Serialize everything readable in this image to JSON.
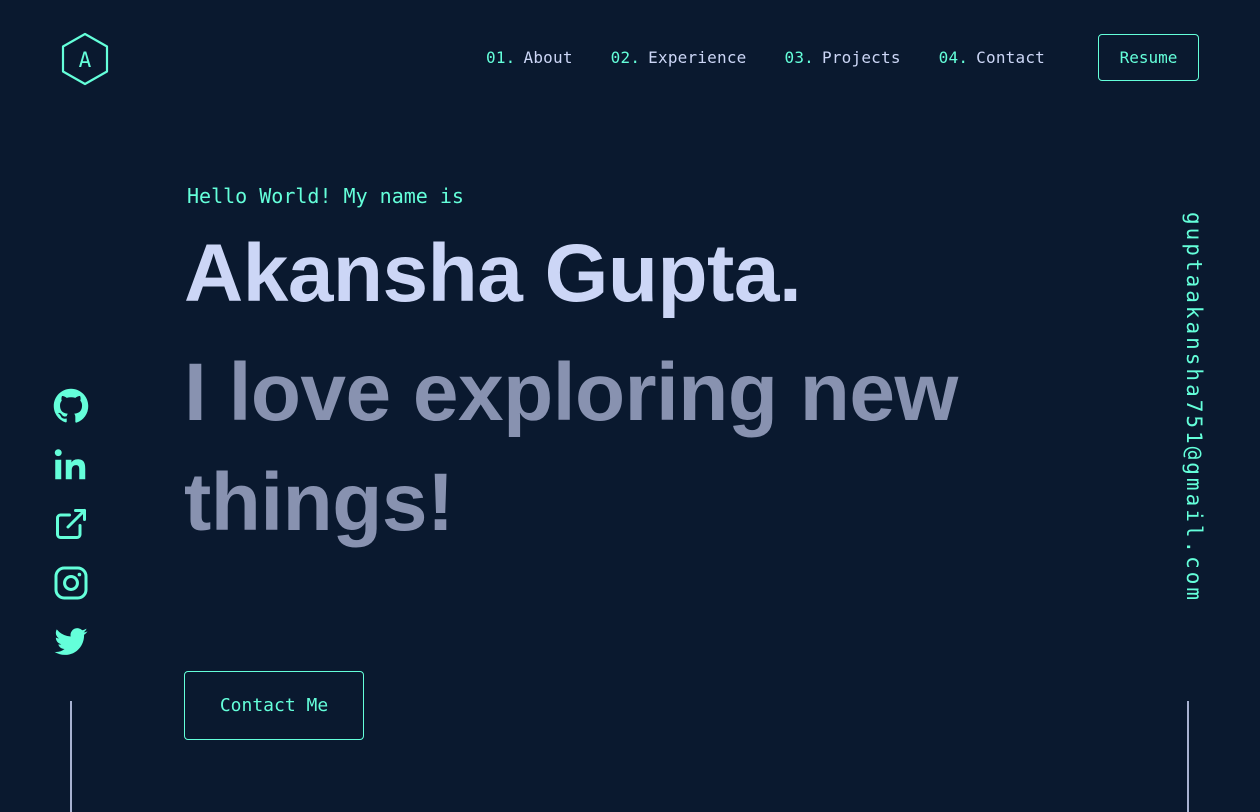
{
  "header": {
    "logo_letter": "A",
    "nav": [
      {
        "num": "01.",
        "label": "About"
      },
      {
        "num": "02.",
        "label": "Experience"
      },
      {
        "num": "03.",
        "label": "Projects"
      },
      {
        "num": "04.",
        "label": "Contact"
      }
    ],
    "resume_label": "Resume"
  },
  "hero": {
    "greeting": "Hello World! My name is",
    "name": "Akansha Gupta.",
    "tagline": "I love exploring new things!",
    "contact_button": "Contact Me"
  },
  "social": [
    "github-icon",
    "linkedin-icon",
    "external-link-icon",
    "instagram-icon",
    "twitter-icon"
  ],
  "email": "guptaakansha751@gmail.com",
  "colors": {
    "background": "#0a192f",
    "accent": "#64ffda",
    "heading": "#ccd6f6",
    "muted": "#8892b0",
    "line": "#a8b2d1"
  }
}
